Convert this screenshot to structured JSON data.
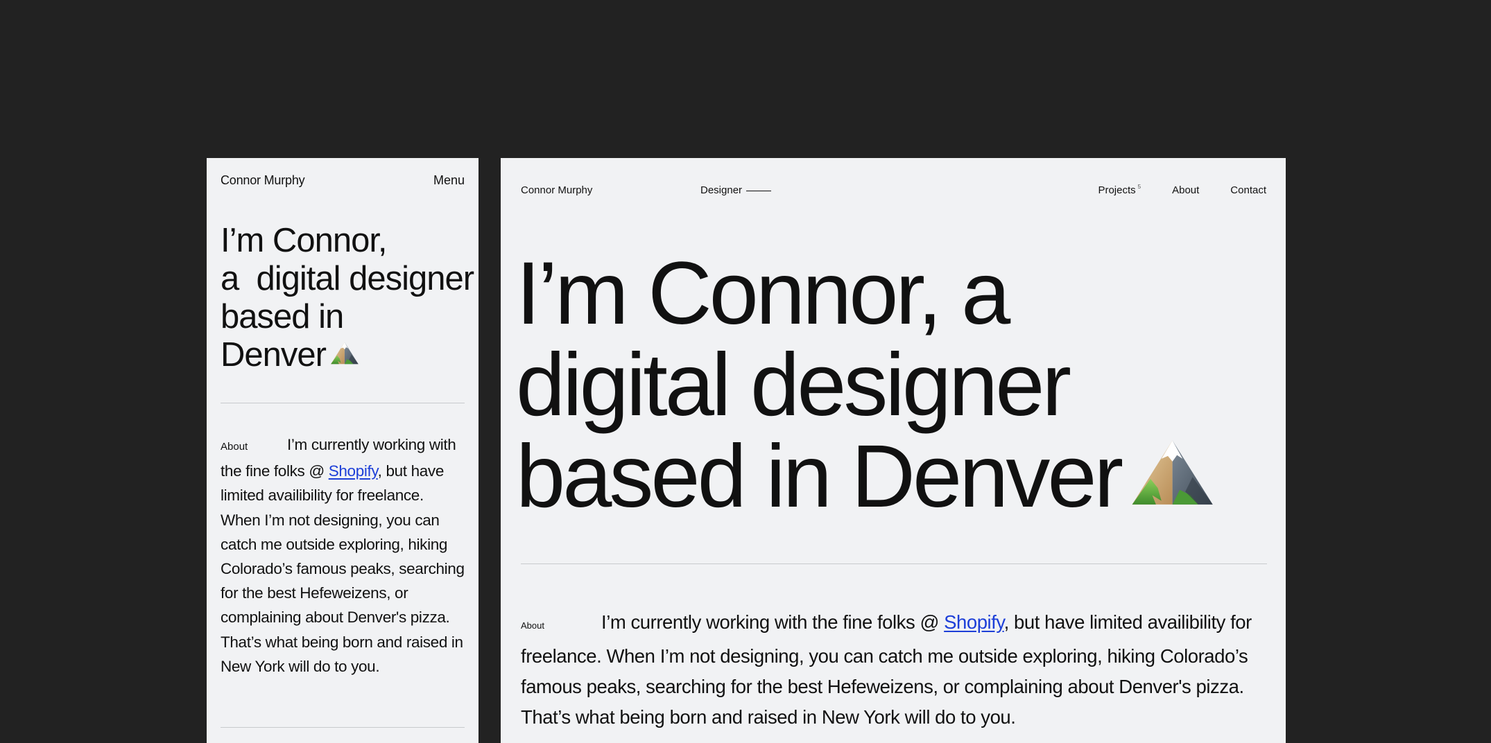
{
  "mobile": {
    "name": "Connor Murphy",
    "menu_label": "Menu",
    "hero": {
      "line1": "I’m Connor,",
      "line2": "a  digital designer",
      "line3": "based in",
      "line4": "Denver"
    },
    "about": {
      "label": "About",
      "before_link": "I’m currently working with the fine folks @ ",
      "link_text": "Shopify",
      "after_link": ", but have limited availibility for freelance. When I’m not designing, you can catch me outside exploring, hiking Colorado’s famous peaks, searching for the best Hefeweizens, or complaining about Denver's pizza. That’s what being born and raised in New York will do to you."
    }
  },
  "desktop": {
    "name": "Connor Murphy",
    "role": "Designer",
    "nav": [
      {
        "label": "Projects",
        "count": "5"
      },
      {
        "label": "About"
      },
      {
        "label": "Contact"
      }
    ],
    "hero": {
      "line1": "I’m Connor, a",
      "line2": "digital designer",
      "line3": "based in Denver"
    },
    "about": {
      "label": "About",
      "before_link": "I’m currently working with the fine folks @ ",
      "link_text": "Shopify",
      "after_link": ", but have limited availibility for freelance. When I’m not designing, you can catch me outside exploring, hiking Colorado’s famous peaks, searching for the best Hefeweizens, or complaining about Denver's pizza. That’s what being born and raised in New York will do to you."
    }
  },
  "icons": {
    "hero_emoji": "mountain-icon"
  },
  "colors": {
    "background": "#222222",
    "panel": "#f1f2f4",
    "link": "#1d3fd8"
  }
}
